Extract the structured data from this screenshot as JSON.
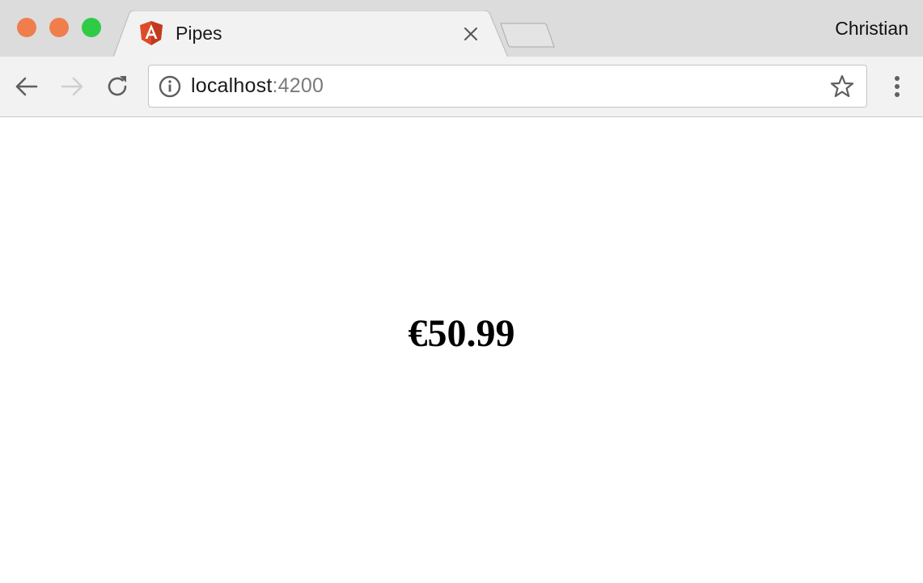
{
  "window": {
    "traffic_lights": {
      "close_color": "#f07e4d",
      "minimize_color": "#f07e4d",
      "maximize_color": "#2fcb47"
    },
    "profile_name": "Christian"
  },
  "tabs": [
    {
      "title": "Pipes",
      "favicon": "angular-logo-icon",
      "active": true
    }
  ],
  "toolbar": {
    "back_icon": "arrow-left-icon",
    "forward_icon": "arrow-right-icon",
    "reload_icon": "reload-icon",
    "menu_icon": "vertical-ellipsis-icon"
  },
  "address_bar": {
    "info_icon": "info-icon",
    "host": "localhost",
    "port": ":4200",
    "bookmark_icon": "star-icon"
  },
  "page": {
    "price": "€50.99"
  }
}
